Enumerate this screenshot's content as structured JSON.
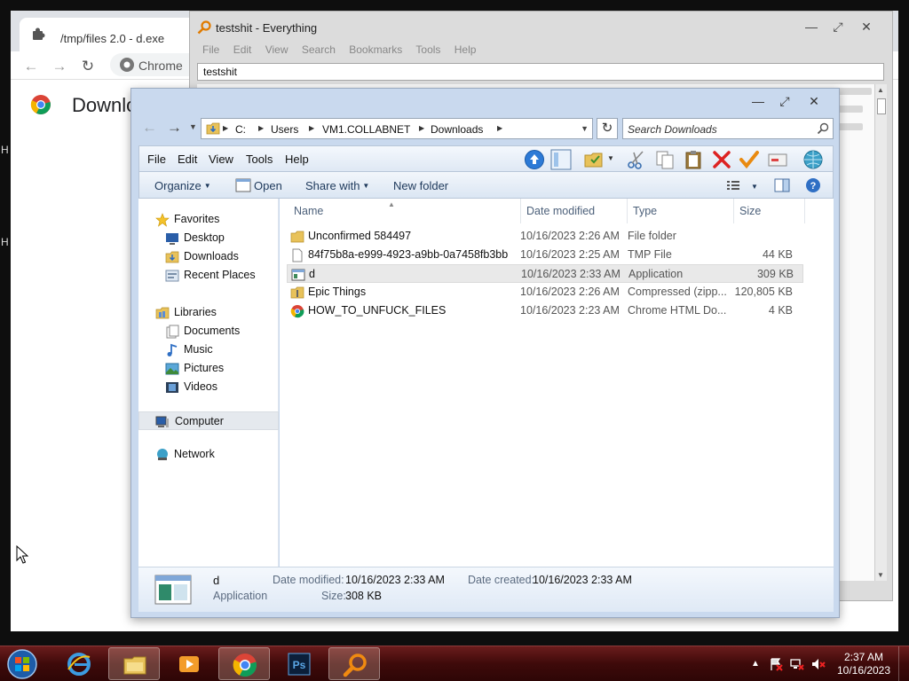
{
  "chrome": {
    "tab_title": "/tmp/files 2.0 - d.exe",
    "omnibox_chip": "Chrome",
    "page_title": "Downloads"
  },
  "everything": {
    "title": "testshit - Everything",
    "menu": [
      "File",
      "Edit",
      "View",
      "Search",
      "Bookmarks",
      "Tools",
      "Help"
    ],
    "search_value": "testshit"
  },
  "explorer": {
    "breadcrumb": [
      "C:",
      "Users",
      "VM1.COLLABNET",
      "Downloads"
    ],
    "search_placeholder": "Search Downloads",
    "menu": [
      "File",
      "Edit",
      "View",
      "Tools",
      "Help"
    ],
    "commands": {
      "organize": "Organize",
      "open": "Open",
      "share_with": "Share with",
      "new_folder": "New folder"
    },
    "nav": {
      "favorites": "Favorites",
      "desktop": "Desktop",
      "downloads": "Downloads",
      "recent_places": "Recent Places",
      "libraries": "Libraries",
      "documents": "Documents",
      "music": "Music",
      "pictures": "Pictures",
      "videos": "Videos",
      "computer": "Computer",
      "network": "Network"
    },
    "columns": [
      "Name",
      "Date modified",
      "Type",
      "Size"
    ],
    "files": [
      {
        "name": "Unconfirmed 584497",
        "date": "10/16/2023 2:26 AM",
        "type": "File folder",
        "size": "",
        "icon": "folder-icon"
      },
      {
        "name": "84f75b8a-e999-4923-a9bb-0a7458fb3bbf....",
        "date": "10/16/2023 2:25 AM",
        "type": "TMP File",
        "size": "44 KB",
        "icon": "file-icon"
      },
      {
        "name": "d",
        "date": "10/16/2023 2:33 AM",
        "type": "Application",
        "size": "309 KB",
        "icon": "application-icon"
      },
      {
        "name": "Epic Things",
        "date": "10/16/2023 2:26 AM",
        "type": "Compressed (zipp...",
        "size": "120,805 KB",
        "icon": "zip-folder-icon"
      },
      {
        "name": "HOW_TO_UNFUCK_FILES",
        "date": "10/16/2023 2:23 AM",
        "type": "Chrome HTML Do...",
        "size": "4 KB",
        "icon": "chrome-icon"
      }
    ],
    "details": {
      "name": "d",
      "type": "Application",
      "date_modified_label": "Date modified:",
      "date_modified": "10/16/2023 2:33 AM",
      "date_created_label": "Date created:",
      "date_created": "10/16/2023 2:33 AM",
      "size_label": "Size:",
      "size": "308 KB"
    }
  },
  "taskbar": {
    "time": "2:37 AM",
    "date": "10/16/2023"
  },
  "colors": {
    "taskbar": "#3e0a0a",
    "explorer_frame": "#c9d9ee",
    "header_text": "#4c607a"
  }
}
